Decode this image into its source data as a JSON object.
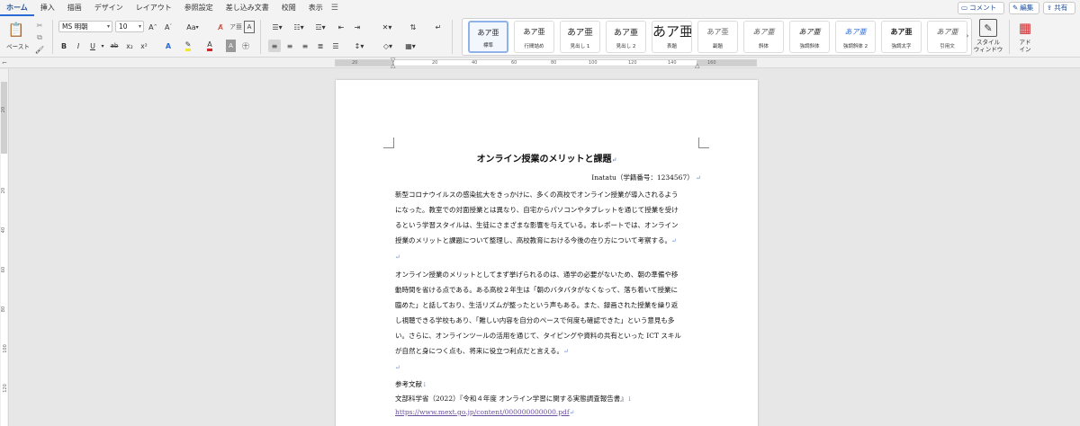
{
  "tabs": [
    "ホーム",
    "挿入",
    "描画",
    "デザイン",
    "レイアウト",
    "参照設定",
    "差し込み文書",
    "校閲",
    "表示"
  ],
  "top_buttons": {
    "comment": "コメント",
    "edit": "編集",
    "share": "共有"
  },
  "ribbon": {
    "paste_label": "ペースト",
    "font_name": "MS 明朝",
    "font_size": "10",
    "case_label": "Aa",
    "bold": "B",
    "italic": "I",
    "underline": "U",
    "strike": "ab",
    "subscript": "x₂",
    "superscript": "x²",
    "styles_pane_label": "スタイル\nウィンドウ",
    "addin_label": "アド\nイン"
  },
  "styles": [
    {
      "preview": "あア亜",
      "name": "標準"
    },
    {
      "preview": "あア亜",
      "name": "行間詰め"
    },
    {
      "preview": "あア亜",
      "name": "見出し 1"
    },
    {
      "preview": "あア亜",
      "name": "見出し 2"
    },
    {
      "preview": "あア亜",
      "name": "表題"
    },
    {
      "preview": "あア亜",
      "name": "副題"
    },
    {
      "preview": "あア亜",
      "name": "斜体"
    },
    {
      "preview": "あア亜",
      "name": "強調斜体"
    },
    {
      "preview": "あア亜",
      "name": "強調斜体 2"
    },
    {
      "preview": "あア亜",
      "name": "強調太字"
    },
    {
      "preview": "あア亜",
      "name": "引用文"
    }
  ],
  "hruler_labels": [
    "20",
    "20",
    "40",
    "60",
    "80",
    "100",
    "120",
    "140",
    "160"
  ],
  "vruler_labels": [
    "20",
    "20",
    "40",
    "60",
    "80",
    "100",
    "120"
  ],
  "document": {
    "title": "オンライン授業のメリットと課題",
    "author": "Inatatu（学籍番号：1234567）",
    "paragraph1_lines": [
      "新型コロナウイルスの感染拡大をきっかけに、多くの高校でオンライン授業が導入されるよう",
      "になった。教室での対面授業とは異なり、自宅からパソコンやタブレットを通じて授業を受け",
      "るという学習スタイルは、生徒にさまざまな影響を与えている。本レポートでは、オンライン",
      "授業のメリットと課題について整理し、高校教育における今後の在り方について考察する。"
    ],
    "paragraph2_lines": [
      "オンライン授業のメリットとしてまず挙げられるのは、通学の必要がないため、朝の準備や移",
      "動時間を省ける点である。ある高校２年生は「朝のバタバタがなくなって、落ち着いて授業に",
      "臨めた」と話しており、生活リズムが整ったという声もある。また、録画された授業を繰り返",
      "し視聴できる学校もあり、「難しい内容を自分のペースで何度も確認できた」という意見も多",
      "い。さらに、オンラインツールの活用を通じて、タイピングや資料の共有といった ICT スキル",
      "が自然と身につく点も、将来に役立つ利点だと言える。"
    ],
    "ref_heading": "参考文献",
    "ref_source": "文部科学省（2022）『令和４年度 オンライン学習に関する実態調査報告書』",
    "ref_url": "https://www.mext.go.jp/content/000000000000.pdf",
    "para_mark": "↵",
    "line_break": "↓"
  }
}
